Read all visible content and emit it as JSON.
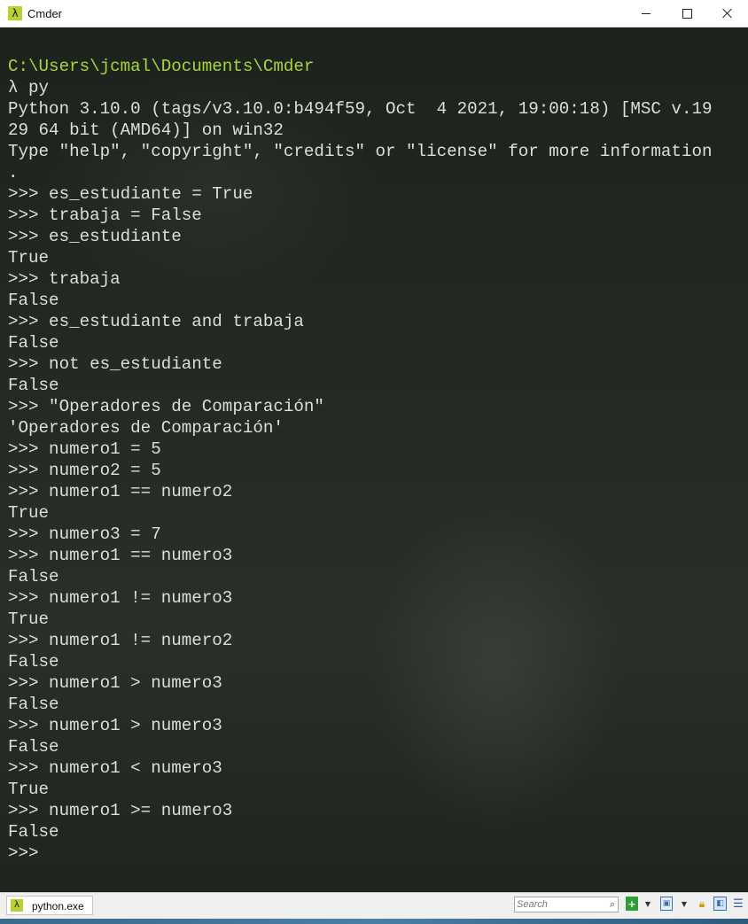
{
  "window": {
    "title": "Cmder",
    "app_icon": "lambda-icon",
    "buttons": [
      "minimize-icon",
      "maximize-icon",
      "close-icon"
    ]
  },
  "console": {
    "lines": [
      {
        "text": "C:\\Users\\jcmal\\Documents\\Cmder",
        "type": "path"
      },
      {
        "text": "λ py",
        "type": "normal"
      },
      {
        "text": "Python 3.10.0 (tags/v3.10.0:b494f59, Oct  4 2021, 19:00:18) [MSC v.19",
        "type": "normal"
      },
      {
        "text": "29 64 bit (AMD64)] on win32",
        "type": "normal"
      },
      {
        "text": "Type \"help\", \"copyright\", \"credits\" or \"license\" for more information",
        "type": "normal"
      },
      {
        "text": ".",
        "type": "normal"
      },
      {
        "text": ">>> es_estudiante = True",
        "type": "normal"
      },
      {
        "text": ">>> trabaja = False",
        "type": "normal"
      },
      {
        "text": ">>> es_estudiante",
        "type": "normal"
      },
      {
        "text": "True",
        "type": "normal"
      },
      {
        "text": ">>> trabaja",
        "type": "normal"
      },
      {
        "text": "False",
        "type": "normal"
      },
      {
        "text": ">>> es_estudiante and trabaja",
        "type": "normal"
      },
      {
        "text": "False",
        "type": "normal"
      },
      {
        "text": ">>> not es_estudiante",
        "type": "normal"
      },
      {
        "text": "False",
        "type": "normal"
      },
      {
        "text": ">>> \"Operadores de Comparación\"",
        "type": "normal"
      },
      {
        "text": "'Operadores de Comparación'",
        "type": "normal"
      },
      {
        "text": ">>> numero1 = 5",
        "type": "normal"
      },
      {
        "text": ">>> numero2 = 5",
        "type": "normal"
      },
      {
        "text": ">>> numero1 == numero2",
        "type": "normal"
      },
      {
        "text": "True",
        "type": "normal"
      },
      {
        "text": ">>> numero3 = 7",
        "type": "normal"
      },
      {
        "text": ">>> numero1 == numero3",
        "type": "normal"
      },
      {
        "text": "False",
        "type": "normal"
      },
      {
        "text": ">>> numero1 != numero3",
        "type": "normal"
      },
      {
        "text": "True",
        "type": "normal"
      },
      {
        "text": ">>> numero1 != numero2",
        "type": "normal"
      },
      {
        "text": "False",
        "type": "normal"
      },
      {
        "text": ">>> numero1 > numero3",
        "type": "normal"
      },
      {
        "text": "False",
        "type": "normal"
      },
      {
        "text": ">>> numero1 > numero3",
        "type": "normal"
      },
      {
        "text": "False",
        "type": "normal"
      },
      {
        "text": ">>> numero1 < numero3",
        "type": "normal"
      },
      {
        "text": "True",
        "type": "normal"
      },
      {
        "text": ">>> numero1 >= numero3",
        "type": "normal"
      },
      {
        "text": "False",
        "type": "normal"
      },
      {
        "text": ">>>",
        "type": "normal"
      }
    ]
  },
  "statusbar": {
    "tab_label": "python.exe",
    "search_placeholder": "Search",
    "colors": {
      "path": "#a8d53d",
      "text": "#dedede",
      "app_icon": "#b9cf34"
    }
  }
}
